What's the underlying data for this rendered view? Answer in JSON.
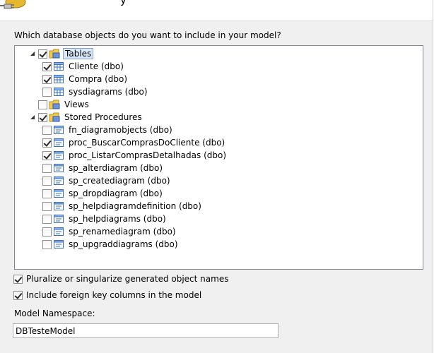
{
  "question": "Which database objects do you want to include in your model?",
  "header": {
    "title_fragment": "y"
  },
  "tree": {
    "tables": {
      "label": "Tables",
      "checked": true,
      "items": [
        {
          "label": "Cliente (dbo)",
          "checked": true
        },
        {
          "label": "Compra (dbo)",
          "checked": true
        },
        {
          "label": "sysdiagrams (dbo)",
          "checked": false
        }
      ]
    },
    "views": {
      "label": "Views",
      "checked": false
    },
    "procs": {
      "label": "Stored Procedures",
      "checked": true,
      "items": [
        {
          "label": "fn_diagramobjects (dbo)",
          "checked": false
        },
        {
          "label": "proc_BuscarComprasDoCliente (dbo)",
          "checked": true
        },
        {
          "label": "proc_ListarComprasDetalhadas (dbo)",
          "checked": true
        },
        {
          "label": "sp_alterdiagram (dbo)",
          "checked": false
        },
        {
          "label": "sp_creatediagram (dbo)",
          "checked": false
        },
        {
          "label": "sp_dropdiagram (dbo)",
          "checked": false
        },
        {
          "label": "sp_helpdiagramdefinition (dbo)",
          "checked": false
        },
        {
          "label": "sp_helpdiagrams (dbo)",
          "checked": false
        },
        {
          "label": "sp_renamediagram (dbo)",
          "checked": false
        },
        {
          "label": "sp_upgraddiagrams (dbo)",
          "checked": false
        }
      ]
    }
  },
  "options": {
    "pluralize": {
      "label": "Pluralize or singularize generated object names",
      "checked": true
    },
    "foreign_keys": {
      "label": "Include foreign key columns in the model",
      "checked": true
    }
  },
  "namespace": {
    "label": "Model Namespace:",
    "value": "DBTesteModel"
  }
}
